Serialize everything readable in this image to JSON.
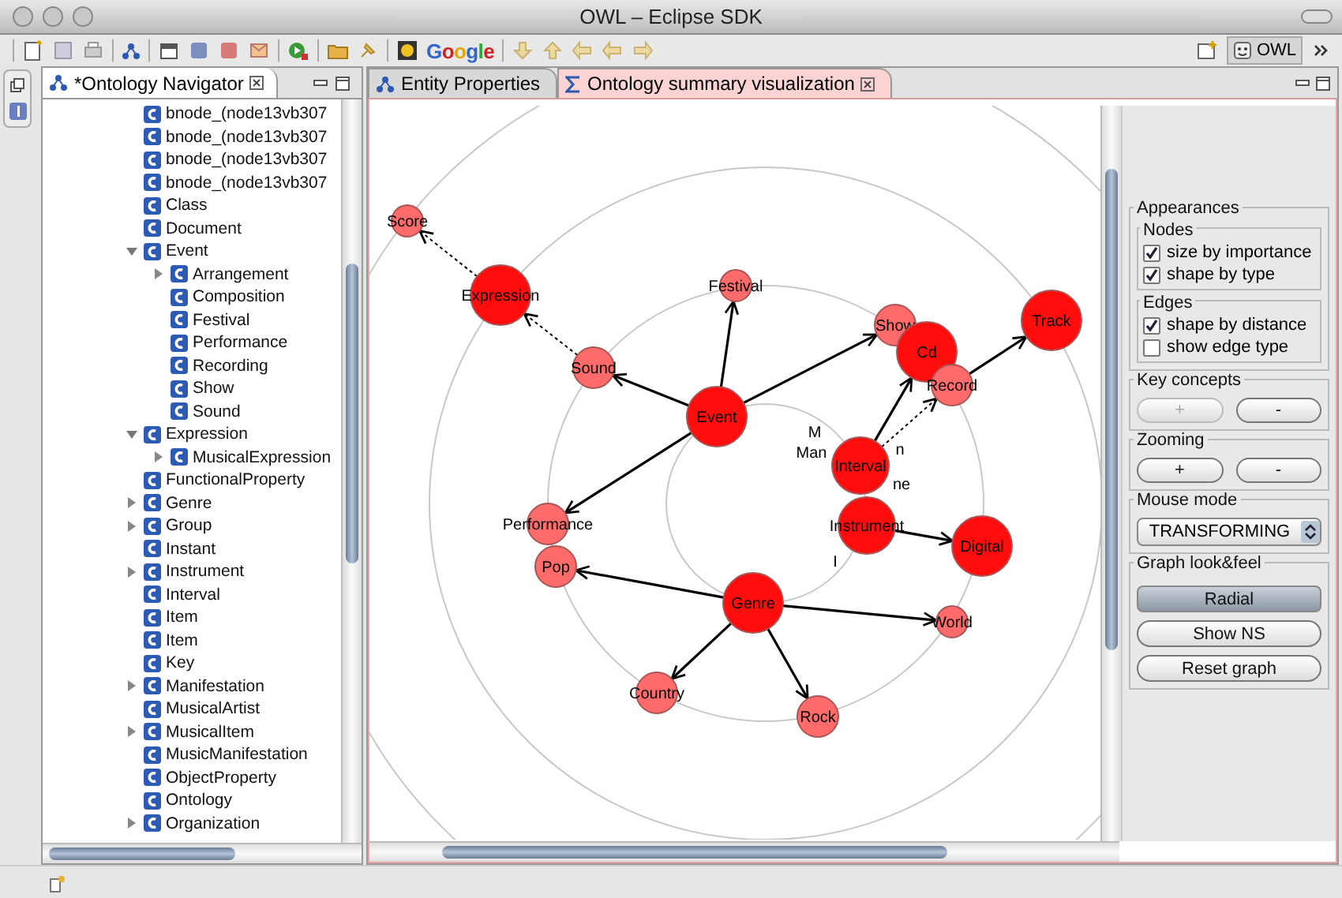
{
  "window": {
    "title": "OWL – Eclipse SDK"
  },
  "toolbar": {
    "search_label": "Google",
    "perspective": "OWL"
  },
  "navigator": {
    "tab": {
      "label": "*Ontology Navigator",
      "selected": true
    },
    "tree": [
      {
        "label": "bnode_(node13vb307"
      },
      {
        "label": "bnode_(node13vb307"
      },
      {
        "label": "bnode_(node13vb307"
      },
      {
        "label": "bnode_(node13vb307"
      },
      {
        "label": "Class"
      },
      {
        "label": "Document"
      },
      {
        "label": "Event",
        "expanded": true,
        "children": [
          {
            "label": "Arrangement",
            "expanded": false
          },
          {
            "label": "Composition"
          },
          {
            "label": "Festival"
          },
          {
            "label": "Performance"
          },
          {
            "label": "Recording"
          },
          {
            "label": "Show"
          },
          {
            "label": "Sound"
          }
        ]
      },
      {
        "label": "Expression",
        "expanded": true,
        "children": [
          {
            "label": "MusicalExpression",
            "expanded": false
          }
        ]
      },
      {
        "label": "FunctionalProperty"
      },
      {
        "label": "Genre",
        "expanded": false
      },
      {
        "label": "Group",
        "expanded": false
      },
      {
        "label": "Instant"
      },
      {
        "label": "Instrument",
        "expanded": false
      },
      {
        "label": "Interval"
      },
      {
        "label": "Item"
      },
      {
        "label": "Item"
      },
      {
        "label": "Key"
      },
      {
        "label": "Manifestation",
        "expanded": false
      },
      {
        "label": "MusicalArtist"
      },
      {
        "label": "MusicalItem",
        "expanded": false
      },
      {
        "label": "MusicManifestation"
      },
      {
        "label": "ObjectProperty"
      },
      {
        "label": "Ontology"
      },
      {
        "label": "Organization",
        "expanded": false
      }
    ]
  },
  "editor": {
    "tabs": [
      {
        "label": "Entity Properties",
        "selected": false
      },
      {
        "label": "Ontology summary visualization",
        "selected": true
      }
    ],
    "graph": {
      "nodes": [
        {
          "label": "Score",
          "kind": "minor"
        },
        {
          "label": "Expression",
          "kind": "major"
        },
        {
          "label": "Festival",
          "kind": "minor"
        },
        {
          "label": "Sound",
          "kind": "minor"
        },
        {
          "label": "Show",
          "kind": "minor"
        },
        {
          "label": "Cd",
          "kind": "major"
        },
        {
          "label": "Track",
          "kind": "major"
        },
        {
          "label": "Record",
          "kind": "minor"
        },
        {
          "label": "Interval",
          "kind": "major"
        },
        {
          "label": "Instrument",
          "kind": "major"
        },
        {
          "label": "Event",
          "kind": "major"
        },
        {
          "label": "Performance",
          "kind": "minor"
        },
        {
          "label": "Pop",
          "kind": "minor"
        },
        {
          "label": "Digital",
          "kind": "major"
        },
        {
          "label": "Genre",
          "kind": "major"
        },
        {
          "label": "World",
          "kind": "minor"
        },
        {
          "label": "Country",
          "kind": "minor"
        },
        {
          "label": "Rock",
          "kind": "minor"
        }
      ],
      "edges": [
        {
          "kind": "solid"
        },
        {
          "kind": "solid"
        },
        {
          "kind": "solid"
        },
        {
          "kind": "solid"
        },
        {
          "kind": "dotted"
        },
        {
          "kind": "dotted"
        },
        {
          "kind": "solid"
        },
        {
          "kind": "dotted"
        },
        {
          "kind": "solid"
        },
        {
          "kind": "solid"
        },
        {
          "kind": "solid"
        },
        {
          "kind": "solid"
        },
        {
          "kind": "solid"
        },
        {
          "kind": "solid"
        }
      ],
      "partial_labels": [
        "M",
        "Man",
        "n",
        "ne",
        "I"
      ]
    },
    "controls": [
      {
        "kind": "nested",
        "title": "Appearances",
        "groups": [
          {
            "title": "Nodes",
            "options": [
              {
                "label": "size by importance",
                "checked": true
              },
              {
                "label": "shape by type",
                "checked": true
              }
            ]
          },
          {
            "title": "Edges",
            "options": [
              {
                "label": "shape by distance",
                "checked": true
              },
              {
                "label": "show edge type",
                "checked": false
              }
            ]
          }
        ]
      },
      {
        "kind": "pair",
        "title": "Key concepts",
        "buttons": [
          {
            "label": "+",
            "disabled": true
          },
          {
            "label": "-",
            "disabled": false
          }
        ]
      },
      {
        "kind": "pair",
        "title": "Zooming",
        "buttons": [
          {
            "label": "+",
            "disabled": false
          },
          {
            "label": "-",
            "disabled": false
          }
        ]
      },
      {
        "kind": "select",
        "title": "Mouse mode",
        "value": "TRANSFORMING"
      },
      {
        "kind": "stack",
        "title": "Graph look&feel",
        "buttons": [
          {
            "label": "Radial",
            "selected": true
          },
          {
            "label": "Show NS",
            "selected": false
          },
          {
            "label": "Reset graph",
            "selected": false
          }
        ]
      }
    ]
  }
}
